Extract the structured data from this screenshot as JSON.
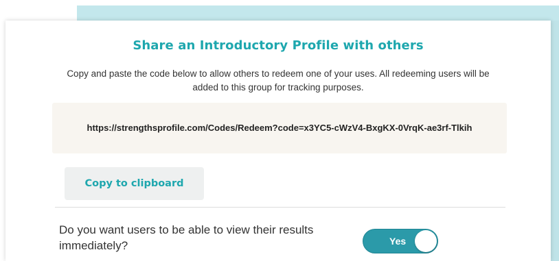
{
  "modal": {
    "title": "Share an Introductory Profile with others",
    "description": "Copy and paste the code below to allow others to redeem one of your uses. All redeeming users will be added to this group for tracking purposes.",
    "code_url": "https://strengthsprofile.com/Codes/Redeem?code=x3YC5-cWzV4-BxgKX-0VrqK-ae3rf-Tlkih",
    "copy_button_label": "Copy to clipboard",
    "question": "Do you want users to be able to view their results immediately?",
    "toggle": {
      "label": "Yes",
      "on": true
    }
  },
  "colors": {
    "accent": "#1ea7ae",
    "toggle_on": "#2b9aa9",
    "backdrop": "#c3e7ec",
    "code_box": "#f8f5f0"
  }
}
